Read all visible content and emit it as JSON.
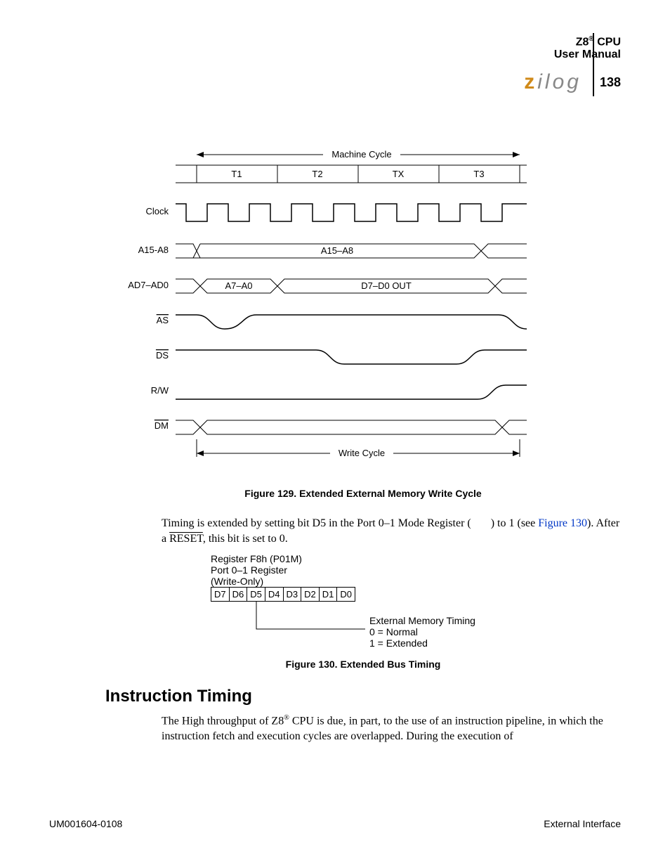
{
  "header": {
    "product_prefix": "Z8",
    "product_suffix": " CPU",
    "subtitle": "User Manual",
    "page_number": "138"
  },
  "figure129": {
    "caption": "Figure 129. Extended External Memory Write Cycle",
    "top_label": "Machine Cycle",
    "states": [
      "T1",
      "T2",
      "TX",
      "T3"
    ],
    "signals": {
      "clock": "Clock",
      "a15_a8": "A15-A8",
      "ad7_ad0": "AD7–AD0",
      "as": "AS",
      "ds": "DS",
      "rw": "R/W",
      "dm": "DM"
    },
    "bus_labels": {
      "a15_a8_mid": "A15–A8",
      "ad_first": "A7–A0",
      "ad_second": "D7–D0  OUT"
    },
    "bottom_label": "Write Cycle"
  },
  "para1": {
    "t1": "Timing is extended by setting bit D5 in the Port 0–1 Mode Register (",
    "t2": ") to 1 (see ",
    "link": "Figure 130",
    "t3": "). After a ",
    "reset": "RESET",
    "t4": ", this bit is set to 0."
  },
  "figure130": {
    "caption": "Figure 130. Extended Bus Timing",
    "reg_line1": "Register F8h (P01M)",
    "reg_line2": "Port 0–1 Register",
    "reg_line3": "(Write-Only)",
    "bits": [
      "D7",
      "D6",
      "D5",
      "D4",
      "D3",
      "D2",
      "D1",
      "D0"
    ],
    "desc_line1": "External Memory Timing",
    "desc_line2": "0 = Normal",
    "desc_line3": "1 = Extended"
  },
  "section_heading": "Instruction Timing",
  "para2": {
    "t1": "The High throughput of Z8",
    "t2": " CPU is due, in part, to the use of an instruction pipeline, in which the instruction fetch and execution cycles are overlapped. During the execution of"
  },
  "footer": {
    "left": "UM001604-0108",
    "right": "External Interface"
  }
}
